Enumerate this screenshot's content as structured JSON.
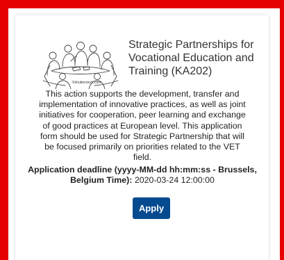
{
  "action": {
    "title": "Strategic Partnerships for Vocational Education and Training (KA202)",
    "image_credit": "©shutterstock.com",
    "description": "This action supports the development, transfer and implementation of innovative practices, as well as joint initiatives for cooperation, peer learning and exchange of good practices at European level. This application form should be used for Strategic Partnership that will be focused primarily on priorities related to the VET field.",
    "deadline_label": "Application deadline (yyyy-MM-dd hh:mm:ss - Brussels, Belgium Time):",
    "deadline_value": "2020-03-24 12:00:00",
    "apply_label": "Apply"
  },
  "colors": {
    "frame_border": "#e60000",
    "apply_button": "#064a8f"
  },
  "icons": {
    "illustration": "team-meeting-sketch-icon"
  }
}
